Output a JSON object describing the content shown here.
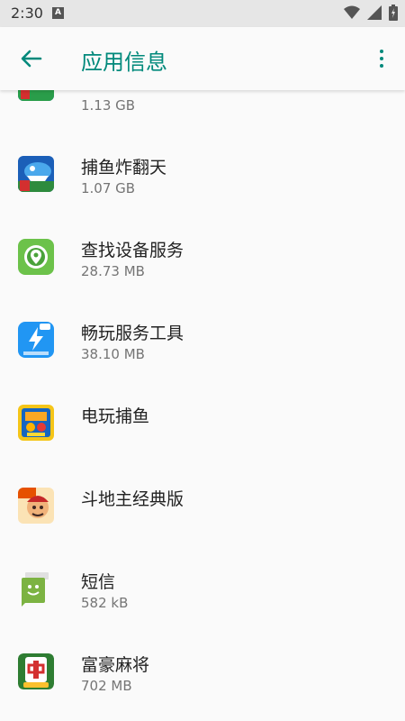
{
  "status_bar": {
    "time": "2:30",
    "notif_letter": "A"
  },
  "app_bar": {
    "title": "应用信息"
  },
  "apps": [
    {
      "name": "",
      "size": "1.13 GB",
      "icon": "fish-game-icon"
    },
    {
      "name": "捕鱼炸翻天",
      "size": "1.07 GB",
      "icon": "fish-game-icon"
    },
    {
      "name": "查找设备服务",
      "size": "28.73 MB",
      "icon": "find-device-icon"
    },
    {
      "name": "畅玩服务工具",
      "size": "38.10 MB",
      "icon": "service-tool-icon"
    },
    {
      "name": "电玩捕鱼",
      "size": "",
      "icon": "arcade-fish-icon"
    },
    {
      "name": "斗地主经典版",
      "size": "",
      "icon": "doudizhu-icon"
    },
    {
      "name": "短信",
      "size": "582 kB",
      "icon": "messaging-icon"
    },
    {
      "name": "富豪麻将",
      "size": "702 MB",
      "icon": "mahjong-icon"
    }
  ],
  "colors": {
    "accent": "#00897b",
    "status_bg": "#e6e6e6",
    "bg": "#fafafa"
  }
}
